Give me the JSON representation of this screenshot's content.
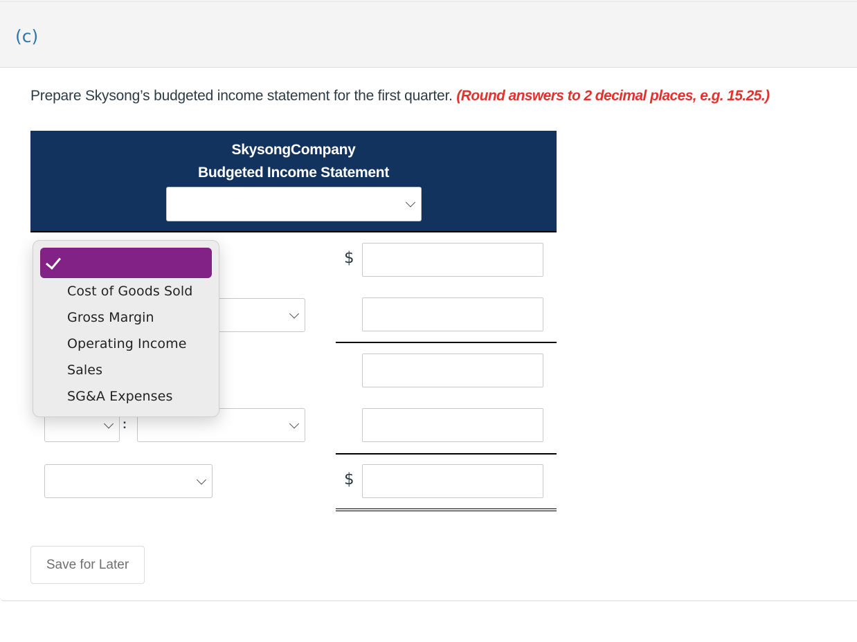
{
  "part": {
    "label": "(c)"
  },
  "question": {
    "instruction": "Prepare Skysong’s budgeted income statement for the first quarter.",
    "hint": "(Round answers to 2 decimal places, e.g. 15.25.)"
  },
  "statement": {
    "company": "SkysongCompany",
    "title": "Budgeted Income Statement",
    "period_select": {
      "value": ""
    },
    "currency_symbol": "$",
    "rows": [
      {
        "label_select": "",
        "amount": "",
        "has_dollar": true
      },
      {
        "label_select": "",
        "amount": "",
        "has_dollar": false
      },
      {
        "label_select": "",
        "amount": "",
        "has_dollar": false
      },
      {
        "label_select_left": "",
        "label_select_right": "",
        "amount": "",
        "has_dollar": false
      },
      {
        "label_select": "",
        "amount": "",
        "has_dollar": true
      }
    ],
    "colon": ":"
  },
  "dropdown": {
    "open": true,
    "selected_index": 0,
    "options": [
      "",
      "Cost of Goods Sold",
      "Gross Margin",
      "Operating Income",
      "Sales",
      "SG&A Expenses"
    ],
    "highlight_color": "#822286"
  },
  "actions": {
    "save_label": "Save for Later"
  },
  "colors": {
    "header_bg": "#13335f",
    "hint": "#e3312b",
    "part_label": "#2e77ab"
  }
}
